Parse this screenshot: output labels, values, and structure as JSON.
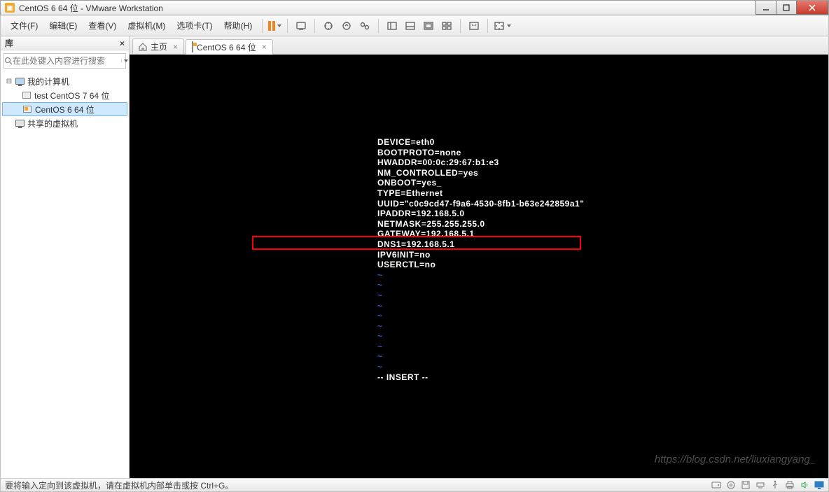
{
  "window": {
    "title": "CentOS 6 64 位 - VMware Workstation"
  },
  "menu": {
    "file": "文件(F)",
    "edit": "编辑(E)",
    "view": "查看(V)",
    "vm": "虚拟机(M)",
    "tabs": "选项卡(T)",
    "help": "帮助(H)"
  },
  "sidebar": {
    "title": "库",
    "search_placeholder": "在此处键入内容进行搜索",
    "root": "我的计算机",
    "items": [
      "test CentOS 7 64 位",
      "CentOS 6 64 位"
    ],
    "shared": "共享的虚拟机"
  },
  "tabs": {
    "home": "主页",
    "active": "CentOS 6 64 位"
  },
  "console": {
    "l1": "DEVICE=eth0",
    "l2": "BOOTPROTO=none",
    "l3": "HWADDR=00:0c:29:67:b1:e3",
    "l4": "NM_CONTROLLED=yes",
    "l5": "ONBOOT=yes_",
    "l6": "TYPE=Ethernet",
    "l7": "UUID=\"c0c9cd47-f9a6-4530-8fb1-b63e242859a1\"",
    "l8": "IPADDR=192.168.5.0",
    "l9": "NETMASK=255.255.255.0",
    "l10": "GATEWAY=192.168.5.1",
    "l11": "DNS1=192.168.5.1",
    "l12": "IPV6INIT=no",
    "l13": "USERCTL=no",
    "tilde": "~",
    "mode": "-- INSERT --"
  },
  "status": {
    "text": "要将输入定向到该虚拟机，请在虚拟机内部单击或按 Ctrl+G。"
  },
  "watermark": "https://blog.csdn.net/liuxiangyang_"
}
